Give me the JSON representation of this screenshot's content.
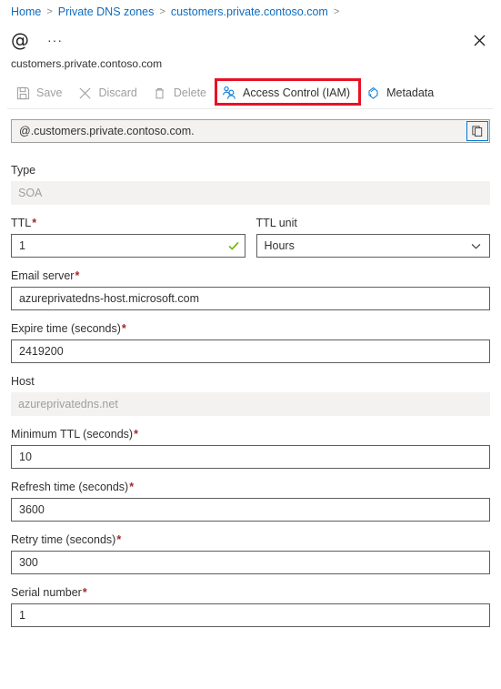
{
  "breadcrumb": {
    "items": [
      {
        "label": "Home"
      },
      {
        "label": "Private DNS zones"
      },
      {
        "label": "customers.private.contoso.com"
      }
    ],
    "separator": ">"
  },
  "header": {
    "title": "@",
    "more_label": "···",
    "subtitle": "customers.private.contoso.com",
    "close_label": "✕"
  },
  "commandbar": {
    "save_label": "Save",
    "discard_label": "Discard",
    "delete_label": "Delete",
    "access_control_label": "Access Control (IAM)",
    "metadata_label": "Metadata",
    "highlight_color": "#e81123"
  },
  "record": {
    "fqdn": "@.customers.private.contoso.com.",
    "copy_title": "Copy to clipboard"
  },
  "fields": {
    "type": {
      "label": "Type",
      "value": "SOA",
      "readonly": true
    },
    "ttl": {
      "label": "TTL",
      "required": true,
      "value": "1"
    },
    "ttl_unit": {
      "label": "TTL unit",
      "value": "Hours"
    },
    "email_server": {
      "label": "Email server",
      "required": true,
      "value": "azureprivatedns-host.microsoft.com"
    },
    "expire_time": {
      "label": "Expire time (seconds)",
      "required": true,
      "value": "2419200"
    },
    "host": {
      "label": "Host",
      "value": "azureprivatedns.net",
      "readonly": true
    },
    "minimum_ttl": {
      "label": "Minimum TTL (seconds)",
      "required": true,
      "value": "10"
    },
    "refresh_time": {
      "label": "Refresh time (seconds)",
      "required": true,
      "value": "3600"
    },
    "retry_time": {
      "label": "Retry time (seconds)",
      "required": true,
      "value": "300"
    },
    "serial_number": {
      "label": "Serial number",
      "required": true,
      "value": "1"
    }
  },
  "required_marker": "*"
}
